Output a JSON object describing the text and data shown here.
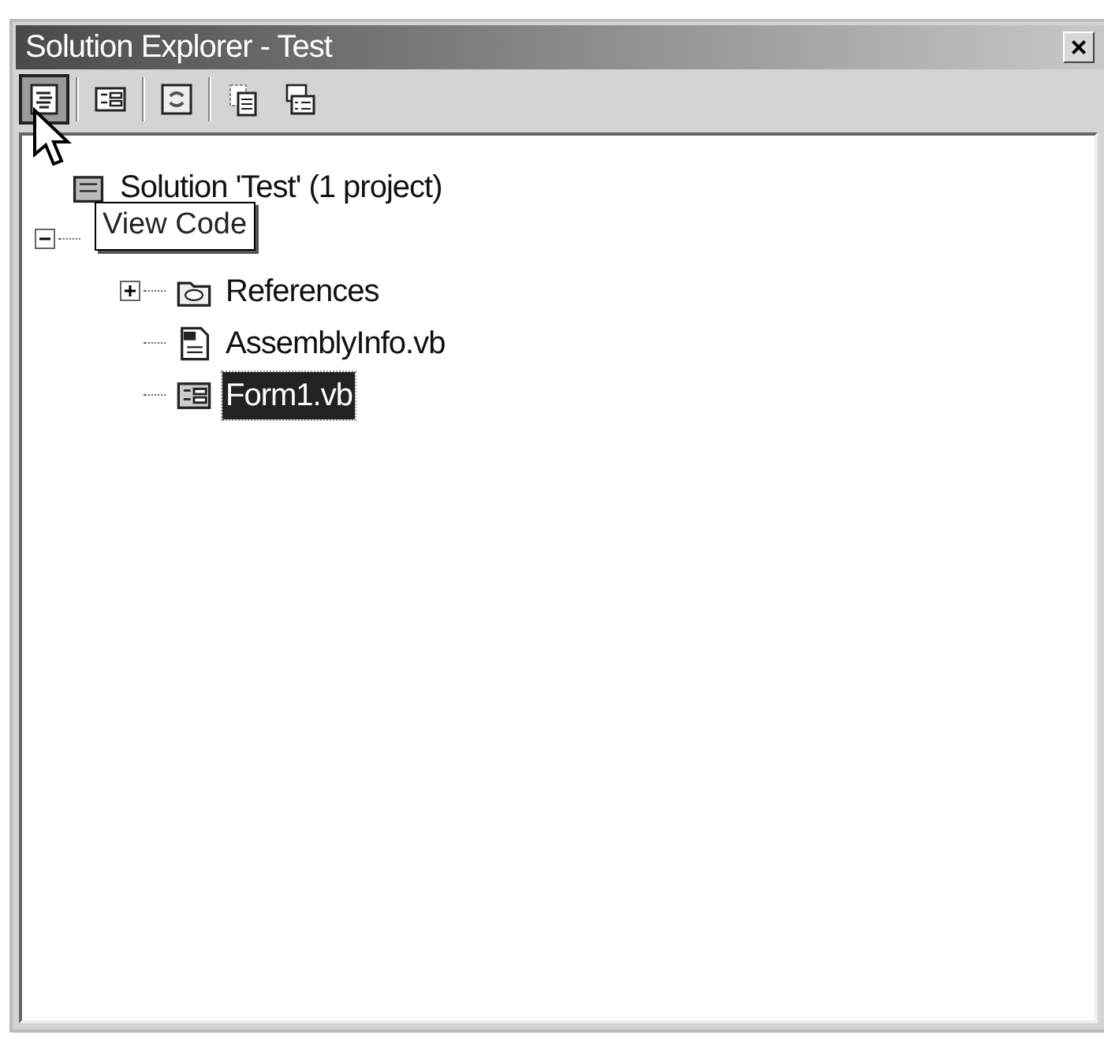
{
  "window": {
    "title": "Solution Explorer - Test",
    "close_label": "×"
  },
  "toolbar": [
    {
      "kind": "view-code",
      "pressed": true
    },
    {
      "kind": "view-designer",
      "pressed": false
    },
    {
      "kind": "refresh",
      "pressed": false
    },
    {
      "kind": "show-all",
      "pressed": false
    },
    {
      "kind": "properties",
      "pressed": false
    }
  ],
  "tooltip": {
    "text": "View Code"
  },
  "tree": [
    {
      "label": "Solution 'Test' (1 project)",
      "kind": "solution",
      "selected": false,
      "children": [
        {
          "expanded": true,
          "children": [
            {
              "label": "References",
              "kind": "references",
              "expanded": false,
              "selected": false
            },
            {
              "label": "AssemblyInfo.vb",
              "kind": "vb-file",
              "selected": false
            },
            {
              "label": "Form1.vb",
              "kind": "form",
              "selected": true
            }
          ]
        }
      ]
    }
  ]
}
